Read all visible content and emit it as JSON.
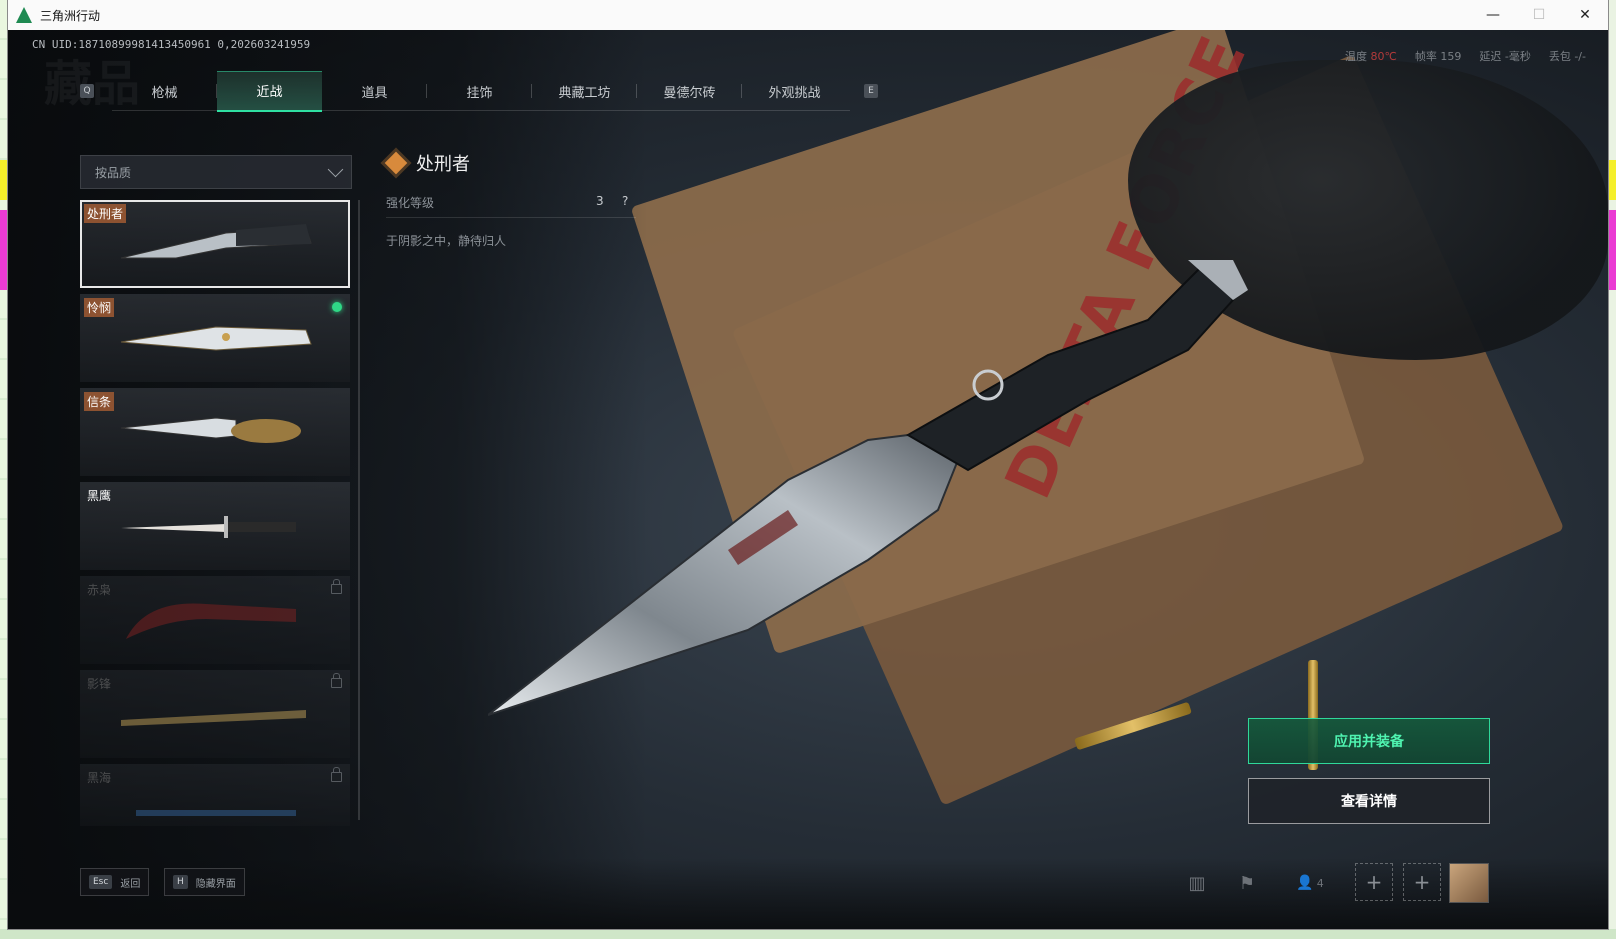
{
  "window": {
    "title": "三角洲行动",
    "controls": {
      "minimize": "—",
      "maximize": "☐",
      "close": "✕"
    }
  },
  "hud": {
    "uid": "CN UID:18710899981413450961 0,202603241959",
    "watermark": "藏品",
    "stats": {
      "temp_label": "温度",
      "temp_value": "80℃",
      "fps_label": "帧率",
      "fps_value": "159",
      "latency": "延迟 -毫秒",
      "loss": "丢包 -/-"
    }
  },
  "tabs": {
    "prev_key": "Q",
    "next_key": "E",
    "items": [
      {
        "label": "枪械",
        "active": false
      },
      {
        "label": "近战",
        "active": true
      },
      {
        "label": "道具",
        "active": false
      },
      {
        "label": "挂饰",
        "active": false
      },
      {
        "label": "典藏工坊",
        "active": false
      },
      {
        "label": "曼德尔砖",
        "active": false
      },
      {
        "label": "外观挑战",
        "active": false
      }
    ]
  },
  "filter": {
    "label": "按品质"
  },
  "melee_list": [
    {
      "name": "处刑者",
      "selected": true,
      "equipped": false,
      "locked": false,
      "quality": "orange"
    },
    {
      "name": "怜悯",
      "selected": false,
      "equipped": true,
      "locked": false,
      "quality": "orange"
    },
    {
      "name": "信条",
      "selected": false,
      "equipped": false,
      "locked": false,
      "quality": "orange"
    },
    {
      "name": "黑鹰",
      "selected": false,
      "equipped": false,
      "locked": false,
      "quality": "none"
    },
    {
      "name": "赤枭",
      "selected": false,
      "equipped": false,
      "locked": true,
      "quality": "dim"
    },
    {
      "name": "影锋",
      "selected": false,
      "equipped": false,
      "locked": true,
      "quality": "dim"
    },
    {
      "name": "黑海",
      "selected": false,
      "equipped": false,
      "locked": true,
      "quality": "dim"
    }
  ],
  "detail": {
    "name": "处刑者",
    "enhance_label": "强化等级",
    "enhance_value": "3",
    "help": "?",
    "description": "于阴影之中，静待归人"
  },
  "actions": {
    "apply_equip": "应用并装备",
    "view_details": "查看详情"
  },
  "bottom": {
    "esc_key": "Esc",
    "esc_label": "返回",
    "hide_key": "H",
    "hide_label": "隐藏界面",
    "squad_count": "4",
    "plus": "+"
  },
  "scene": {
    "folder_text": "DELTA FORCE"
  },
  "colors": {
    "accent": "#2fe0a2",
    "quality_orange": "#a05a32",
    "equipped_dot": "#2fd886",
    "temp_hot": "#b23a3a"
  },
  "icons": [
    "stats-icon",
    "flag-icon",
    "squad-icon",
    "plus-icon",
    "lock-icon",
    "chevron-down-icon",
    "quality-diamond-icon"
  ]
}
